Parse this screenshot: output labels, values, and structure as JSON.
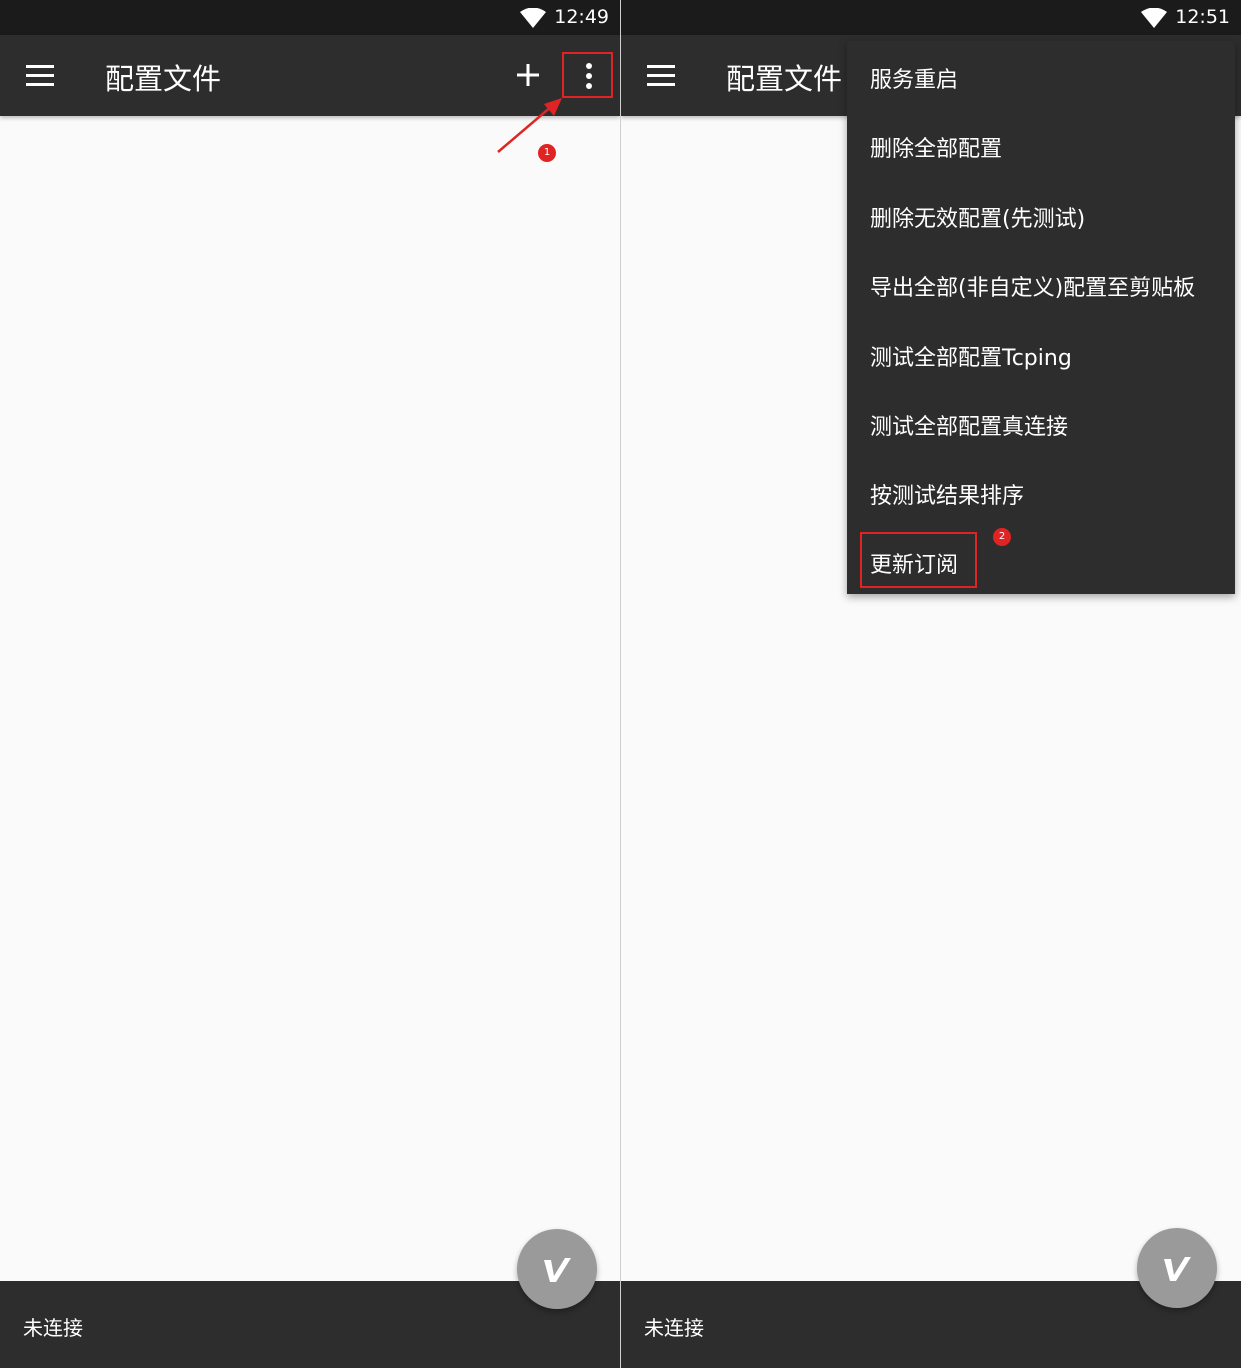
{
  "left_screen": {
    "status_time": "12:49",
    "title": "配置文件",
    "bottom_status": "未连接",
    "annotation_badge": "1"
  },
  "right_screen": {
    "status_time": "12:51",
    "title": "配置文件",
    "bottom_status": "未连接",
    "annotation_badge": "2",
    "menu_items": [
      "服务重启",
      "删除全部配置",
      "删除无效配置(先测试)",
      "导出全部(非自定义)配置至剪贴板",
      "测试全部配置Tcping",
      "测试全部配置真连接",
      "按测试结果排序",
      "更新订阅"
    ]
  },
  "colors": {
    "status_bar": "#1b1b1b",
    "toolbar": "#2d2d2d",
    "content": "#fafafa",
    "fab": "#9a9a9a",
    "annotation": "#e02424"
  },
  "icons": [
    "wifi-icon",
    "menu-icon",
    "add-icon",
    "more-vert-icon",
    "v2ray-logo-icon",
    "annotation-arrow"
  ]
}
